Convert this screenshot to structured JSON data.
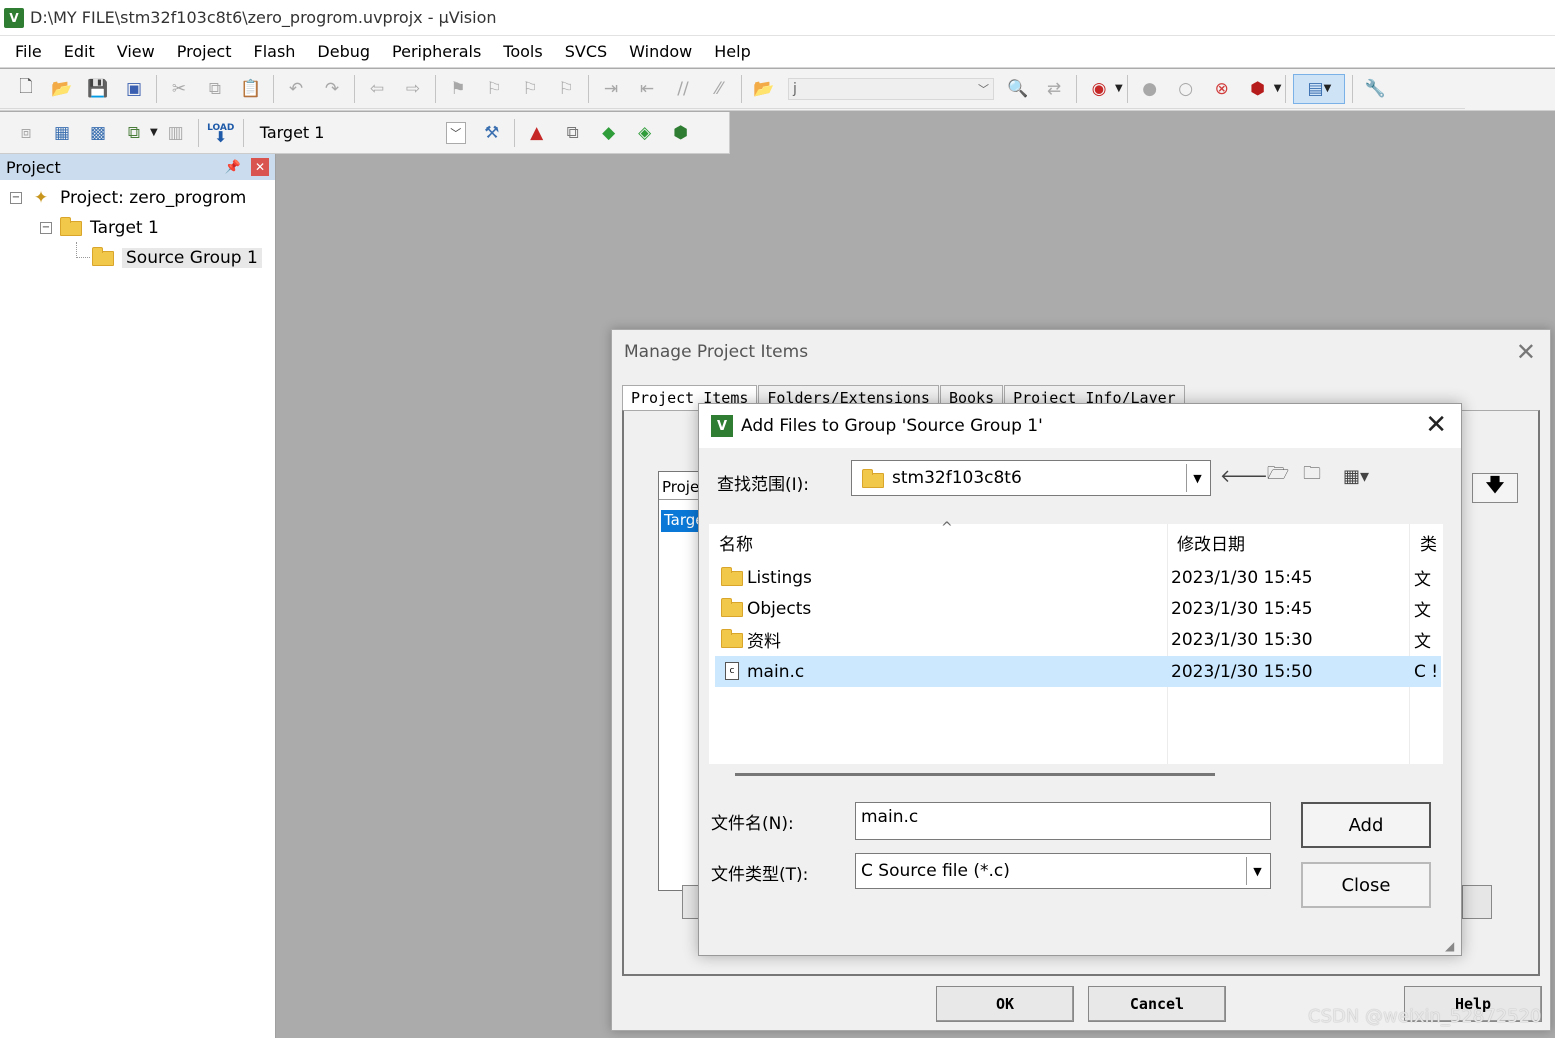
{
  "window": {
    "title": "D:\\MY FILE\\stm32f103c8t6\\zero_progrom.uvprojx - µVision",
    "icon": "uvision-icon"
  },
  "menu": [
    "File",
    "Edit",
    "View",
    "Project",
    "Flash",
    "Debug",
    "Peripherals",
    "Tools",
    "SVCS",
    "Window",
    "Help"
  ],
  "toolbar": {
    "find_value": "j",
    "target_value": "Target 1",
    "load_label": "LOAD"
  },
  "project_panel": {
    "title": "Project",
    "tree": {
      "project": "Project: zero_progrom",
      "target": "Target 1",
      "group": "Source Group 1"
    }
  },
  "manage_dialog": {
    "title": "Manage Project Items",
    "tabs": [
      "Project Items",
      "Folders/Extensions",
      "Books",
      "Project Info/Layer"
    ],
    "list_header": "Projec",
    "list_selected": "Targe",
    "buttons": {
      "ok": "OK",
      "cancel": "Cancel",
      "help": "Help"
    }
  },
  "add_dialog": {
    "title": "Add Files to Group 'Source Group 1'",
    "look_in_label": "查找范围(I):",
    "look_in_value": "stm32f103c8t6",
    "columns": {
      "name": "名称",
      "date": "修改日期",
      "type": "类"
    },
    "files": [
      {
        "name": "Listings",
        "date": "2023/1/30 15:45",
        "type": "文",
        "kind": "folder"
      },
      {
        "name": "Objects",
        "date": "2023/1/30 15:45",
        "type": "文",
        "kind": "folder"
      },
      {
        "name": "资料",
        "date": "2023/1/30 15:30",
        "type": "文",
        "kind": "folder"
      },
      {
        "name": "main.c",
        "date": "2023/1/30 15:50",
        "type": "C !",
        "kind": "file",
        "selected": true
      }
    ],
    "filename_label": "文件名(N):",
    "filename_value": "main.c",
    "filetype_label": "文件类型(T):",
    "filetype_value": "C Source file (*.c)",
    "add_label": "Add",
    "close_label": "Close"
  },
  "watermark": "CSDN @weixin_52872520",
  "colors": {
    "selection": "#cce8ff",
    "panel_header": "#ccdcef",
    "list_sel": "#0a78d7"
  }
}
